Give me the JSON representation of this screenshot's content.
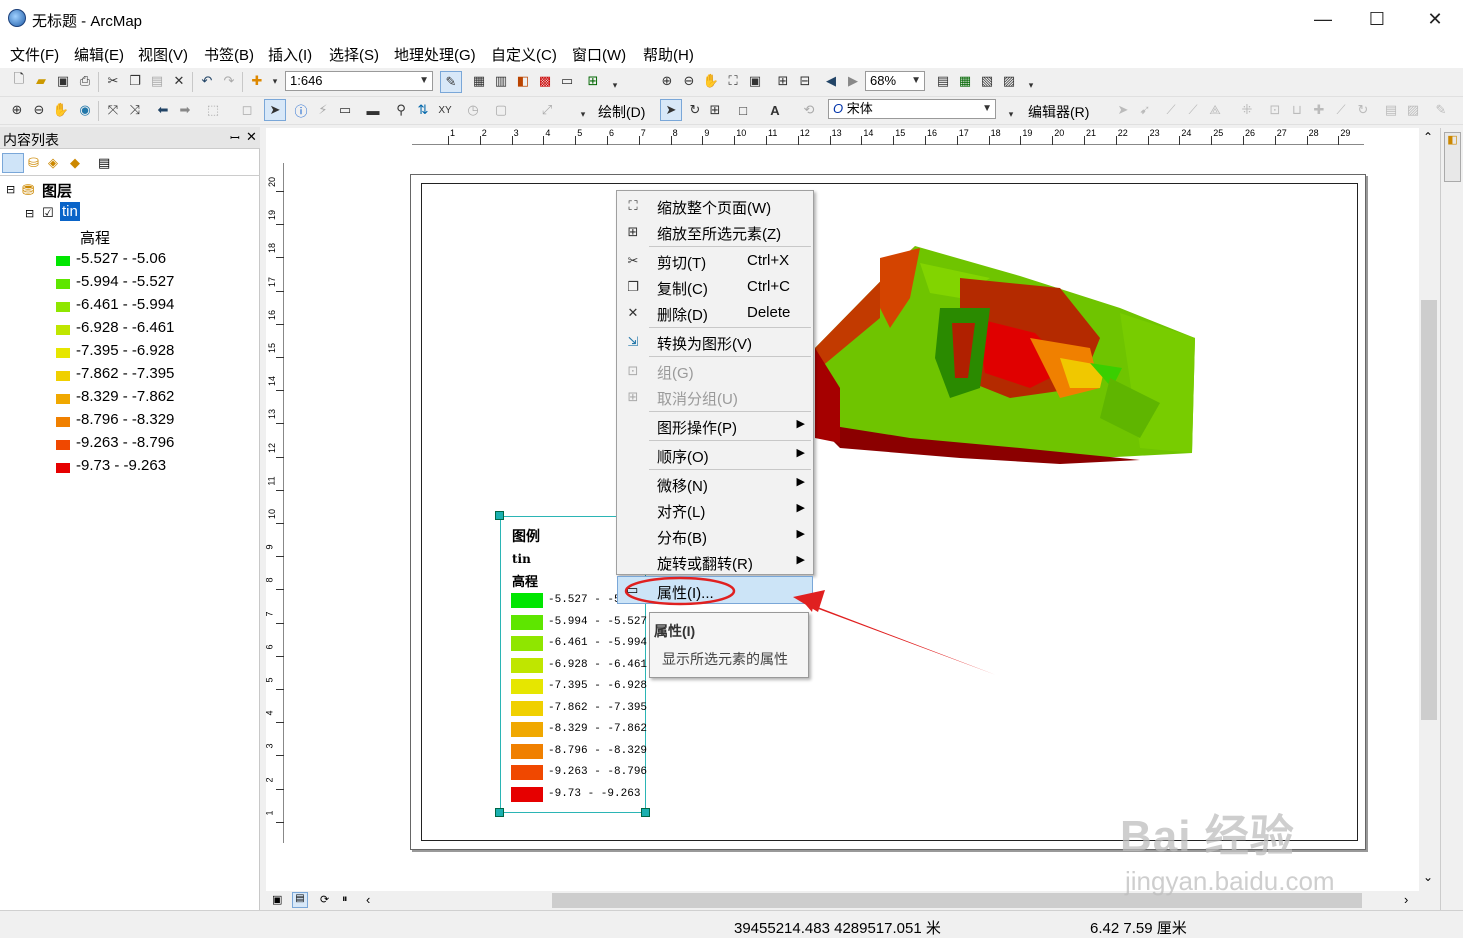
{
  "window": {
    "title": "无标题 - ArcMap",
    "minimize": "—",
    "maximize": "☐",
    "close": "✕"
  },
  "menubar": [
    "文件(F)",
    "编辑(E)",
    "视图(V)",
    "书签(B)",
    "插入(I)",
    "选择(S)",
    "地理处理(G)",
    "自定义(C)",
    "窗口(W)",
    "帮助(H)"
  ],
  "toolbar": {
    "scale": "1:646",
    "zoom": "68%",
    "draw_label": "绘制(D)",
    "font": "宋体",
    "editor_label": "编辑器(R)"
  },
  "toc": {
    "title": "内容列表",
    "pin": "ꟷ",
    "close": "✕",
    "root": "图层",
    "layer": "tin",
    "field": "高程",
    "classes": [
      {
        "label": "-5.527 - -5.06",
        "color": "#00e600"
      },
      {
        "label": "-5.994 - -5.527",
        "color": "#5ee600"
      },
      {
        "label": "-6.461 - -5.994",
        "color": "#8fe600"
      },
      {
        "label": "-6.928 - -6.461",
        "color": "#bfe600"
      },
      {
        "label": "-7.395 - -6.928",
        "color": "#e6e600"
      },
      {
        "label": "-7.862 - -7.395",
        "color": "#f0d000"
      },
      {
        "label": "-8.329 - -7.862",
        "color": "#f0a800"
      },
      {
        "label": "-8.796 - -8.329",
        "color": "#f08000"
      },
      {
        "label": "-9.263 - -8.796",
        "color": "#f04800"
      },
      {
        "label": "-9.73 - -9.263",
        "color": "#e60000"
      }
    ]
  },
  "legend": {
    "title": "图例",
    "layer": "tin",
    "field": "高程",
    "items": [
      "-5.527 - -5.",
      "-5.994 - -5.527",
      "-6.461 - -5.994",
      "-6.928 - -6.461",
      "-7.395 - -6.928",
      "-7.862 - -7.395",
      "-8.329 - -7.862",
      "-8.796 - -8.329",
      "-9.263 - -8.796",
      "-9.73 - -9.263"
    ]
  },
  "context_menu": {
    "zoom_page": "缩放整个页面(W)",
    "zoom_selected": "缩放至所选元素(Z)",
    "cut": "剪切(T)",
    "cut_sc": "Ctrl+X",
    "copy": "复制(C)",
    "copy_sc": "Ctrl+C",
    "delete": "删除(D)",
    "delete_sc": "Delete",
    "convert": "转换为图形(V)",
    "group": "组(G)",
    "ungroup": "取消分组(U)",
    "graphic_ops": "图形操作(P)",
    "order": "顺序(O)",
    "nudge": "微移(N)",
    "align": "对齐(L)",
    "distribute": "分布(B)",
    "rotate": "旋转或翻转(R)",
    "properties": "属性(I)..."
  },
  "tooltip": {
    "title": "属性(I)",
    "desc": "显示所选元素的属性"
  },
  "ruler_h": [
    "1",
    "2",
    "3",
    "4",
    "5",
    "6",
    "7",
    "8",
    "9",
    "10",
    "11",
    "12",
    "13",
    "14",
    "15",
    "16",
    "17",
    "18",
    "19",
    "20",
    "21",
    "22",
    "23",
    "24",
    "25",
    "26",
    "27",
    "28",
    "29"
  ],
  "ruler_v": [
    "20",
    "19",
    "18",
    "17",
    "16",
    "15",
    "14",
    "13",
    "12",
    "11",
    "10",
    "9",
    "8",
    "7",
    "6",
    "5",
    "4",
    "3",
    "2",
    "1"
  ],
  "status": {
    "coords": "39455214.483  4289517.051 米",
    "page_coords": "6.42  7.59 厘米"
  },
  "watermark": {
    "brand": "Bai 经验",
    "url": "jingyan.baidu.com"
  }
}
